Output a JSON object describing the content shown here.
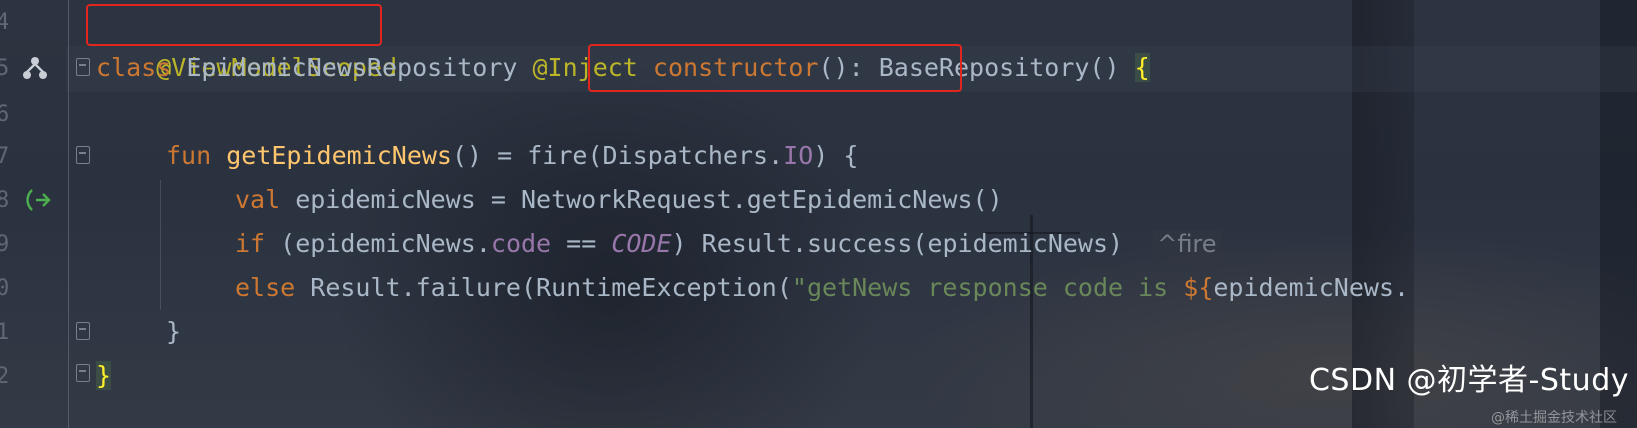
{
  "editor": {
    "line_numbers": [
      "4",
      "5",
      "6",
      "7",
      "8",
      "9",
      "0",
      "1",
      "2"
    ],
    "gutter_icons": {
      "implemented": "hierarchy-icon",
      "suspend_call": "suspend-arrow-icon"
    },
    "lines": {
      "l4": {
        "annotation": "@ViewModelScoped"
      },
      "l5": {
        "kw_class": "class",
        "class_name": " EpidemicNewsRepository ",
        "inject": "@Inject",
        "space": " ",
        "ctor": "constructor",
        "ctor_parens": "()",
        "rest": ": BaseRepository() ",
        "brace": "{"
      },
      "l7": {
        "kw_fun": "fun",
        "fn_name": "getEpidemicNews",
        "rest1": "() = fire(Dispatchers.",
        "io": "IO",
        "rest2": ") {"
      },
      "l8": {
        "kw_val": "val",
        "rest": " epidemicNews = NetworkRequest.getEpidemicNews()"
      },
      "l9": {
        "kw_if": "if",
        "rest1": " (epidemicNews.",
        "code_prop": "code",
        "rest2": " == ",
        "code_const": "CODE",
        "rest3": ") Result.success(epidemicNews)",
        "hint": "^fire"
      },
      "l10": {
        "kw_else": "else",
        "rest1": " Result.failure(RuntimeException(",
        "str": "\"getNews response code is ",
        "tmpl": "${",
        "rest2": "epidemicNews."
      },
      "l11": {
        "brace": "}"
      },
      "l12": {
        "brace": "}"
      }
    }
  },
  "watermark": {
    "main": "CSDN @初学者-Study",
    "sub": "@稀土掘金技术社区"
  },
  "colors": {
    "keyword": "#cc7832",
    "function": "#ffc66d",
    "annotation": "#bbb529",
    "string": "#6a8759",
    "property": "#9876aa",
    "plain": "#a9b7c6",
    "highlight_box": "#e0261f"
  }
}
